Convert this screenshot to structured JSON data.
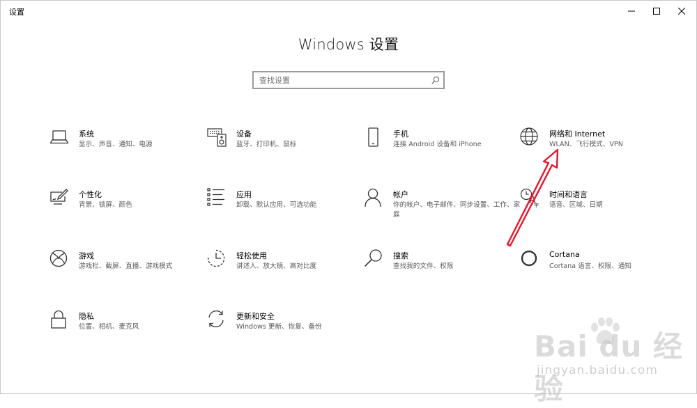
{
  "window": {
    "title": "设置"
  },
  "heading": "Windows 设置",
  "search": {
    "placeholder": "查找设置",
    "value": ""
  },
  "tiles": [
    {
      "title": "系统",
      "desc": "显示、声音、通知、电源",
      "icon": "laptop-icon"
    },
    {
      "title": "设备",
      "desc": "蓝牙、打印机、鼠标",
      "icon": "keyboard-speaker-icon"
    },
    {
      "title": "手机",
      "desc": "连接 Android 设备和 iPhone",
      "icon": "phone-icon"
    },
    {
      "title": "网络和 Internet",
      "desc": "WLAN、飞行模式、VPN",
      "icon": "globe-icon"
    },
    {
      "title": "个性化",
      "desc": "背景、锁屏、颜色",
      "icon": "paintbrush-icon"
    },
    {
      "title": "应用",
      "desc": "卸载、默认应用、可选功能",
      "icon": "apps-list-icon"
    },
    {
      "title": "帐户",
      "desc": "你的帐户、电子邮件、同步设置、工作、家庭",
      "icon": "person-icon"
    },
    {
      "title": "时间和语言",
      "desc": "语音、区域、日期",
      "icon": "time-language-icon"
    },
    {
      "title": "游戏",
      "desc": "游戏栏、截屏、直播、游戏模式",
      "icon": "xbox-icon"
    },
    {
      "title": "轻松使用",
      "desc": "讲述人、放大镜、高对比度",
      "icon": "ease-of-access-icon"
    },
    {
      "title": "搜索",
      "desc": "查找我的文件、权限",
      "icon": "magnifier-icon"
    },
    {
      "title": "Cortana",
      "desc": "Cortana 语言、权限、通知",
      "icon": "cortana-ring-icon"
    },
    {
      "title": "隐私",
      "desc": "位置、相机、麦克风",
      "icon": "lock-icon"
    },
    {
      "title": "更新和安全",
      "desc": "Windows 更新、恢复、备份",
      "icon": "sync-icon"
    }
  ],
  "watermark": {
    "logo": "Bai du 经验",
    "url": "jingyan.baidu.com"
  },
  "colors": {
    "annotation_arrow": "#e8162c",
    "text_secondary": "#5a5a5a",
    "watermark": "#bebebe"
  }
}
